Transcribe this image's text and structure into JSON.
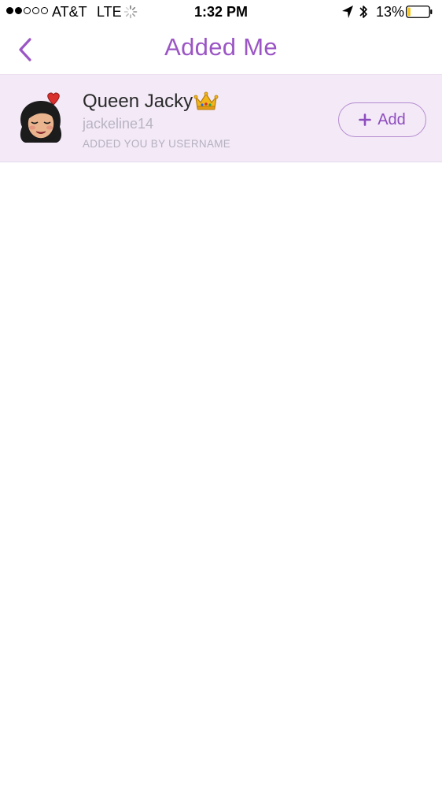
{
  "status_bar": {
    "signal_bars_filled": 2,
    "signal_bars_total": 5,
    "carrier": "AT&T",
    "network": "LTE",
    "time": "1:32 PM",
    "battery_percent": "13%",
    "battery_level": 0.13,
    "battery_color": "#F5C518",
    "icons": [
      "loading-spinner-icon",
      "location-arrow-icon",
      "bluetooth-icon",
      "battery-icon"
    ]
  },
  "nav": {
    "title": "Added Me",
    "back_icon": "chevron-left-icon",
    "accent_color": "#9B55C5"
  },
  "friends": [
    {
      "display_name": "Queen Jacky",
      "name_emoji": "crown-icon",
      "username": "jackeline14",
      "added_via": "ADDED YOU BY USERNAME",
      "add_label": "Add",
      "add_icon": "plus-icon",
      "row_color": "#F3E9F7"
    }
  ]
}
